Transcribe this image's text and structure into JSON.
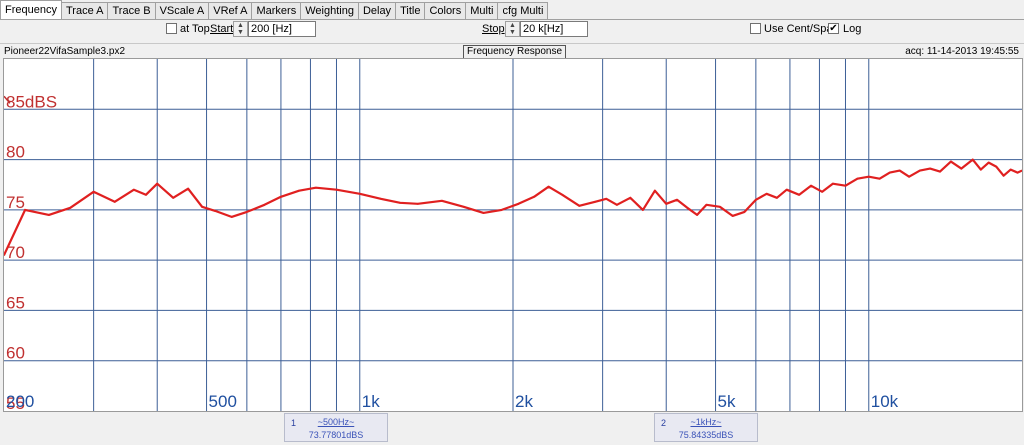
{
  "tabs": [
    "Frequency",
    "Trace A",
    "Trace B",
    "VScale A",
    "VRef A",
    "Markers",
    "Weighting",
    "Delay",
    "Title",
    "Colors",
    "Multi",
    "cfg Multi"
  ],
  "controls": {
    "at_top_label": "at Top",
    "at_top_checked": false,
    "start_label": "Start",
    "start_value": "200 [Hz]",
    "stop_label": "Stop",
    "stop_value": "20 k[Hz]",
    "cent_span_label": "Use Cent/Span",
    "cent_span_checked": false,
    "log_label": "Log",
    "log_checked": true
  },
  "info": {
    "filename": "Pioneer22VifaSample3.px2",
    "graph_title": "Frequency Response",
    "acq": "acq: 11-14-2013 19:45:55"
  },
  "colors": {
    "trace": "#e02020",
    "grid": "#3d5f96",
    "ytick": "#c03030",
    "xtick": "#2050a0"
  },
  "markers": [
    {
      "num": "1",
      "freq": "~500Hz~",
      "value": "73.77801dBS"
    },
    {
      "num": "2",
      "freq": "~1kHz~",
      "value": "75.84335dBS"
    }
  ],
  "chart_data": {
    "type": "line",
    "x_scale": "log",
    "xlim": [
      200,
      20000
    ],
    "ylim": [
      55,
      90
    ],
    "y_ticks": [
      "85dBS",
      "80",
      "75",
      "70",
      "65",
      "60",
      "55"
    ],
    "x_ticks": [
      "200",
      "500",
      "1k",
      "2k",
      "5k",
      "10k"
    ],
    "grid": true,
    "series": [
      {
        "x": [
          200,
          220,
          245,
          270,
          300,
          330,
          360,
          380,
          400,
          430,
          460,
          490,
          520,
          560,
          600,
          650,
          700,
          760,
          820,
          900,
          1000,
          1100,
          1200,
          1300,
          1450,
          1600,
          1750,
          1900,
          2050,
          2200,
          2350,
          2500,
          2700,
          2900,
          3050,
          3200,
          3400,
          3600,
          3800,
          4000,
          4200,
          4400,
          4600,
          4800,
          5100,
          5400,
          5700,
          6000,
          6300,
          6600,
          6900,
          7300,
          7700,
          8100,
          8500,
          9000,
          9500,
          10000,
          10500,
          11000,
          11500,
          12000,
          12600,
          13200,
          13800,
          14500,
          15200,
          16000,
          16600,
          17200,
          17800,
          18400,
          19000,
          19600,
          20000
        ],
        "y": [
          70.5,
          75.0,
          74.5,
          75.2,
          76.8,
          75.8,
          77.0,
          76.5,
          77.6,
          76.2,
          77.1,
          75.3,
          74.9,
          74.3,
          74.8,
          75.5,
          76.3,
          76.9,
          77.2,
          77.0,
          76.6,
          76.1,
          75.7,
          75.6,
          75.9,
          75.3,
          74.7,
          75.0,
          75.6,
          76.3,
          77.3,
          76.5,
          75.4,
          75.8,
          76.1,
          75.5,
          76.2,
          75.0,
          76.9,
          75.6,
          76.0,
          75.2,
          74.5,
          75.5,
          75.3,
          74.4,
          74.8,
          76.0,
          76.6,
          76.2,
          77.0,
          76.5,
          77.4,
          76.8,
          77.6,
          77.4,
          78.1,
          78.3,
          78.1,
          78.7,
          78.9,
          78.3,
          78.9,
          79.1,
          78.8,
          79.8,
          79.1,
          80.0,
          79.0,
          79.7,
          79.3,
          78.4,
          79.0,
          78.7,
          78.9
        ]
      }
    ]
  }
}
